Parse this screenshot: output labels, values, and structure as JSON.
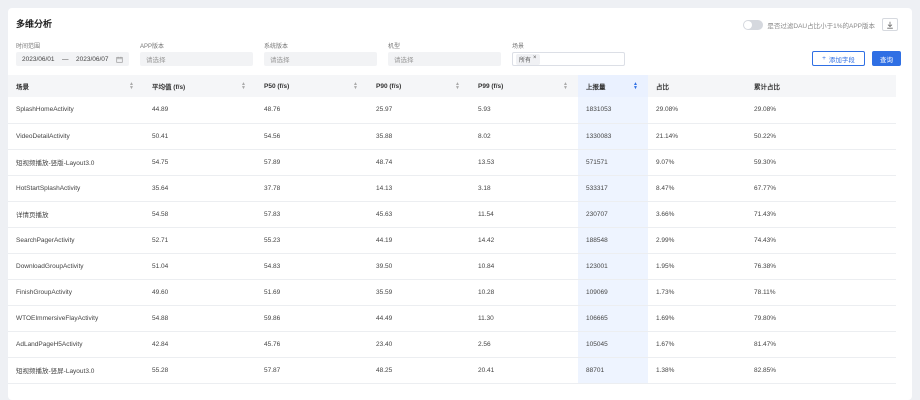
{
  "page_title": "多维分析",
  "toggle_label": "是否过滤DAU占比小于1%的APP版本",
  "filters": [
    {
      "label": "时间范围",
      "start": "2023/06/01",
      "sep": "—",
      "end": "2023/06/07"
    },
    {
      "label": "APP版本",
      "placeholder": "请选择"
    },
    {
      "label": "系统版本",
      "placeholder": "请选择"
    },
    {
      "label": "机型",
      "placeholder": "请选择"
    },
    {
      "label": "场景",
      "tag": "所有",
      "tag_close": "×"
    }
  ],
  "buttons": {
    "custom_label": "添加字段",
    "custom_plus": "+",
    "query_label": "查询"
  },
  "table": {
    "headers": [
      "场景",
      "平均值 (f/s)",
      "P50 (f/s)",
      "P90 (f/s)",
      "P99 (f/s)",
      "上报量",
      "占比",
      "累计占比"
    ],
    "sorted_col": 5,
    "rows": [
      [
        "SplashHomeActivity",
        "44.89",
        "48.76",
        "25.97",
        "5.93",
        "1831053",
        "29.08%",
        "29.08%"
      ],
      [
        "VideoDetailActivity",
        "50.41",
        "54.56",
        "35.88",
        "8.02",
        "1330083",
        "21.14%",
        "50.22%"
      ],
      [
        "短视频播放-竖版-Layout3.0",
        "54.75",
        "57.89",
        "48.74",
        "13.53",
        "571571",
        "9.07%",
        "59.30%"
      ],
      [
        "HotStartSplashActivity",
        "35.64",
        "37.78",
        "14.13",
        "3.18",
        "533317",
        "8.47%",
        "67.77%"
      ],
      [
        "详情页播放",
        "54.58",
        "57.83",
        "45.63",
        "11.54",
        "230707",
        "3.66%",
        "71.43%"
      ],
      [
        "SearchPagerActivity",
        "52.71",
        "55.23",
        "44.19",
        "14.42",
        "188548",
        "2.99%",
        "74.43%"
      ],
      [
        "DownloadGroupActivity",
        "51.04",
        "54.83",
        "39.50",
        "10.84",
        "123001",
        "1.95%",
        "76.38%"
      ],
      [
        "FinishGroupActivity",
        "49.60",
        "51.69",
        "35.59",
        "10.28",
        "109069",
        "1.73%",
        "78.11%"
      ],
      [
        "WTOEImmersiveFlayActivity",
        "54.88",
        "59.86",
        "44.49",
        "11.30",
        "106665",
        "1.69%",
        "79.80%"
      ],
      [
        "AdLandPageH5Activity",
        "42.84",
        "45.76",
        "23.40",
        "2.56",
        "105045",
        "1.67%",
        "81.47%"
      ],
      [
        "短视频播放-竖屏-Layout3.0",
        "55.28",
        "57.87",
        "48.25",
        "20.41",
        "88701",
        "1.38%",
        "82.85%"
      ]
    ]
  }
}
